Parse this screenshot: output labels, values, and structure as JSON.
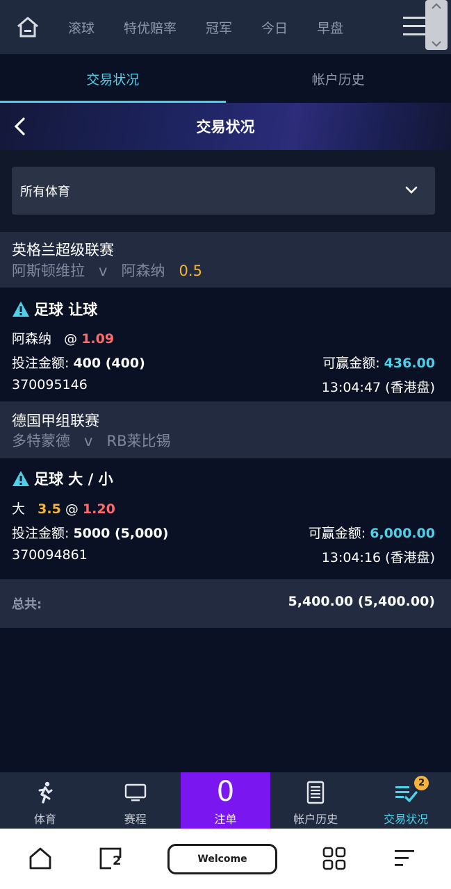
{
  "topnav": {
    "items": [
      "滚球",
      "特优赔率",
      "冠军",
      "今日",
      "早盘"
    ]
  },
  "tabs": {
    "active": "交易状况",
    "inactive": "帐户历史"
  },
  "header": {
    "title": "交易状况"
  },
  "filter": {
    "value": "所有体育"
  },
  "bets": [
    {
      "league": "英格兰超级联赛",
      "home": "阿斯顿维拉",
      "vs": "v",
      "away": "阿森纳",
      "handicap": "0.5",
      "bet_type": "足球 让球",
      "selection": "阿森纳",
      "line": "",
      "at": "@",
      "odds": "1.09",
      "stake_label": "投注金额:",
      "stake": "400 (400)",
      "win_label": "可赢金额:",
      "win": "436.00",
      "ref": "370095146",
      "time": "13:04:47 (香港盘)"
    },
    {
      "league": "德国甲组联赛",
      "home": "多特蒙德",
      "vs": "v",
      "away": "RB莱比锡",
      "handicap": "",
      "bet_type": "足球 大 / 小",
      "selection": "大",
      "line": "3.5",
      "at": "@",
      "odds": "1.20",
      "stake_label": "投注金额:",
      "stake": "5000 (5,000)",
      "win_label": "可赢金额:",
      "win": "6,000.00",
      "ref": "370094861",
      "time": "13:04:16 (香港盘)"
    }
  ],
  "total": {
    "label": "总共:",
    "value": "5,400.00 (5,400.00)"
  },
  "tabbar": {
    "sports": "体育",
    "schedule": "赛程",
    "slip_count": "0",
    "slip": "注单",
    "history": "帐户历史",
    "status": "交易状况",
    "status_badge": "2"
  },
  "sysbar": {
    "welcome": "Welcome",
    "tabs_count": "2"
  },
  "colors": {
    "accent": "#4fd0e8",
    "odds": "#ff6b6b",
    "handicap": "#f4b33a",
    "slip_bg": "#7a17f0"
  }
}
